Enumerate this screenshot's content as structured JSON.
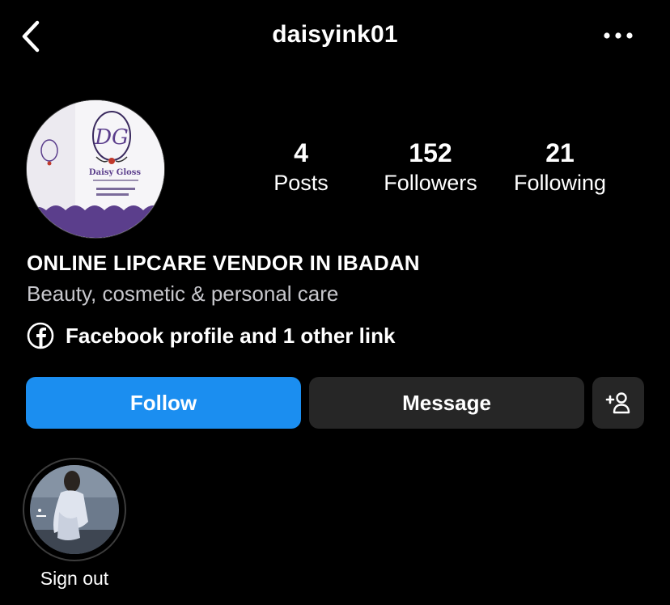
{
  "header": {
    "username": "daisyink01",
    "back_icon": "chevron-left-icon",
    "more_icon": "more-horizontal-icon"
  },
  "profile": {
    "avatar_brand_monogram": "DG",
    "avatar_brand_name": "Daisy Gloss",
    "stats": [
      {
        "value": "4",
        "label": "Posts"
      },
      {
        "value": "152",
        "label": "Followers"
      },
      {
        "value": "21",
        "label": "Following"
      }
    ]
  },
  "bio": {
    "name": "ONLINE LIPCARE VENDOR IN IBADAN",
    "category": "Beauty, cosmetic & personal care",
    "link_icon": "facebook-icon",
    "link_text": "Facebook profile and 1 other link"
  },
  "actions": {
    "follow_label": "Follow",
    "message_label": "Message",
    "add_icon": "add-person-icon"
  },
  "highlights": [
    {
      "label": "Sign out"
    }
  ],
  "colors": {
    "background": "#000000",
    "follow_button": "#1b8ef0",
    "secondary_button": "#262626",
    "brand_purple": "#5b3e8c"
  }
}
